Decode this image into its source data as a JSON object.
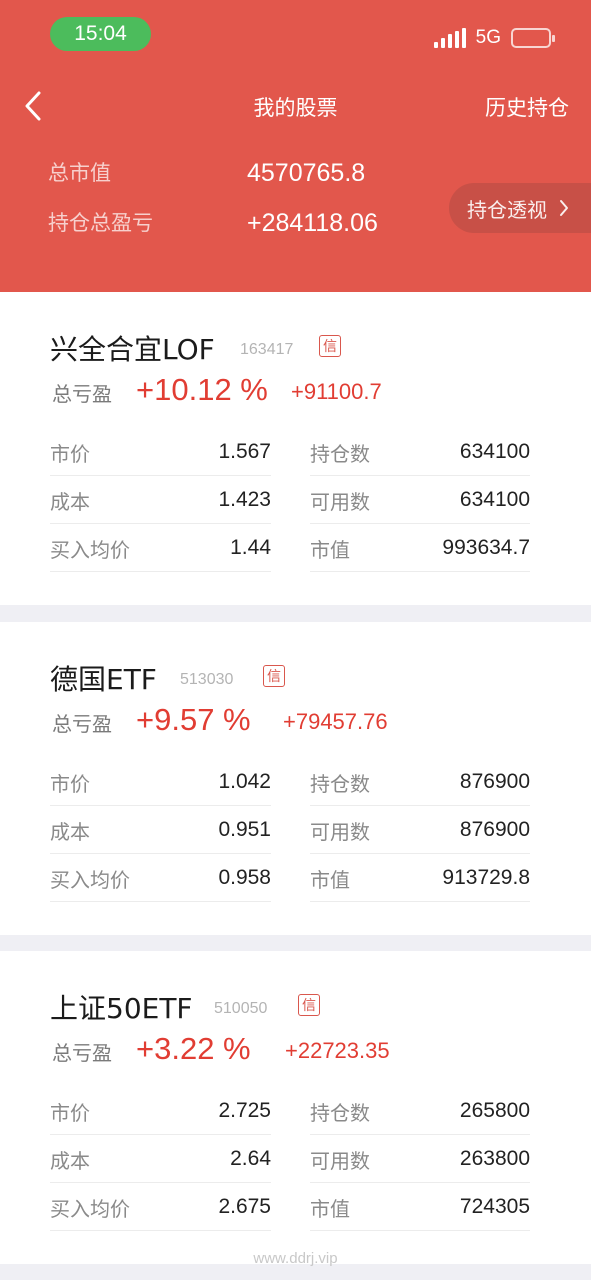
{
  "status_bar": {
    "time": "15:04",
    "network": "5G"
  },
  "nav": {
    "title": "我的股票",
    "history": "历史持仓"
  },
  "summary": {
    "market_value_label": "总市值",
    "market_value": "4570765.8",
    "total_pl_label": "持仓总盈亏",
    "total_pl": "+284118.06",
    "insight_button": "持仓透视"
  },
  "stocks": [
    {
      "name": "兴全合宜LOF",
      "code": "163417",
      "badge": "信",
      "pl_label": "总亏盈",
      "pl_pct": "+10.12 %",
      "pl_amount": "+91100.7",
      "rows": [
        {
          "l_label": "市价",
          "l_value": "1.567",
          "r_label": "持仓数",
          "r_value": "634100"
        },
        {
          "l_label": "成本",
          "l_value": "1.423",
          "r_label": "可用数",
          "r_value": "634100"
        },
        {
          "l_label": "买入均价",
          "l_value": "1.44",
          "r_label": "市值",
          "r_value": "993634.7"
        }
      ]
    },
    {
      "name": "德国ETF",
      "code": "513030",
      "badge": "信",
      "pl_label": "总亏盈",
      "pl_pct": "+9.57 %",
      "pl_amount": "+79457.76",
      "rows": [
        {
          "l_label": "市价",
          "l_value": "1.042",
          "r_label": "持仓数",
          "r_value": "876900"
        },
        {
          "l_label": "成本",
          "l_value": "0.951",
          "r_label": "可用数",
          "r_value": "876900"
        },
        {
          "l_label": "买入均价",
          "l_value": "0.958",
          "r_label": "市值",
          "r_value": "913729.8"
        }
      ]
    },
    {
      "name": "上证50ETF",
      "code": "510050",
      "badge": "信",
      "pl_label": "总亏盈",
      "pl_pct": "+3.22 %",
      "pl_amount": "+22723.35",
      "rows": [
        {
          "l_label": "市价",
          "l_value": "2.725",
          "r_label": "持仓数",
          "r_value": "265800"
        },
        {
          "l_label": "成本",
          "l_value": "2.64",
          "r_label": "可用数",
          "r_value": "263800"
        },
        {
          "l_label": "买入均价",
          "l_value": "2.675",
          "r_label": "市值",
          "r_value": "724305"
        }
      ]
    }
  ],
  "watermark": "www.ddrj.vip",
  "colors": {
    "header_bg": "#e2574c",
    "profit_red": "#e13d33",
    "time_pill_green": "#4cbc5c"
  }
}
